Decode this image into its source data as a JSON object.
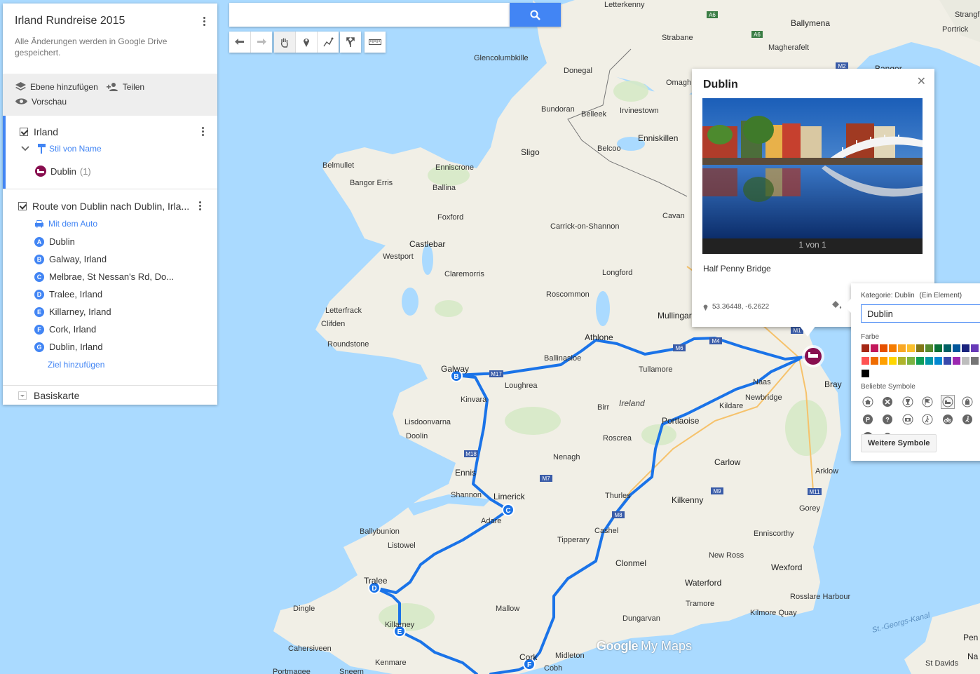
{
  "app": {
    "title": "Irland Rundreise 2015",
    "subtitle": "Alle Änderungen werden in Google Drive gespeichert.",
    "logo_text_1": "Google",
    "logo_text_2": "My Maps"
  },
  "toolbar": {
    "add_layer": "Ebene hinzufügen",
    "share": "Teilen",
    "preview": "Vorschau"
  },
  "search": {
    "value": "",
    "placeholder": ""
  },
  "layers": [
    {
      "name": "Irland",
      "style_label": "Stil von Name",
      "items": [
        {
          "label": "Dublin",
          "count": "(1)"
        }
      ]
    },
    {
      "name": "Route von Dublin nach Dublin, Irla...",
      "mode": "Mit dem Auto",
      "stops": [
        {
          "letter": "A",
          "label": "Dublin"
        },
        {
          "letter": "B",
          "label": "Galway, Irland"
        },
        {
          "letter": "C",
          "label": "Melbrae, St Nessan's Rd, Do..."
        },
        {
          "letter": "D",
          "label": "Tralee, Irland"
        },
        {
          "letter": "E",
          "label": "Killarney, Irland"
        },
        {
          "letter": "F",
          "label": "Cork, Irland"
        },
        {
          "letter": "G",
          "label": "Dublin, Irland"
        }
      ],
      "add_destination": "Ziel hinzufügen"
    }
  ],
  "basemap": {
    "label": "Basiskarte"
  },
  "info_window": {
    "title": "Dublin",
    "photo_counter": "1 von 1",
    "description": "Half Penny Bridge",
    "coordinates": "53.36448, -6.2622"
  },
  "style_popup": {
    "category": "Kategorie: Dublin",
    "count": "(Ein Element)",
    "name_value": "Dublin",
    "color_heading": "Farbe",
    "icons_heading": "Beliebte Symbole",
    "more_button": "Weitere Symbole",
    "colors": [
      "#a52714",
      "#c2185b",
      "#e65100",
      "#f57c00",
      "#f9a825",
      "#fbc02d",
      "#827717",
      "#558b2f",
      "#097138",
      "#006064",
      "#01579b",
      "#1a237e",
      "#673ab7",
      "#880e4f",
      "#ff5252",
      "#ef6c00",
      "#ffa000",
      "#ffd600",
      "#afb42b",
      "#7cb342",
      "#0f9d58",
      "#0097a7",
      "#0288d1",
      "#3949ab",
      "#9c27b0",
      "#bdbdbd",
      "#757575",
      "#424242",
      "#000000"
    ],
    "icons": [
      "home-icon",
      "close-icon",
      "trophy-icon",
      "flag-icon",
      "hotel-icon",
      "shopping-icon",
      "parking-icon",
      "help-icon",
      "camera-icon",
      "hiking-icon",
      "cycling-icon",
      "running-icon",
      "star-icon",
      "pin-icon"
    ]
  },
  "map": {
    "accent": "#4285f4",
    "route_color": "#1a73e8",
    "marker_color": "#880e4f",
    "labels": {
      "letterkenny": "Letterkenny",
      "ballymena": "Ballymena",
      "strabane": "Strabane",
      "magherafelt": "Magherafelt",
      "glencolumbkille": "Glencolumbkille",
      "donegal": "Donegal",
      "omagh": "Omagh",
      "bundoran": "Bundoran",
      "belleek": "Belleek",
      "irvinestown": "Irvinestown",
      "enniskillen": "Enniskillen",
      "belcoo": "Belcoo",
      "sligo": "Sligo",
      "belmullet": "Belmullet",
      "enniscrone": "Enniscrone",
      "bangorerris": "Bangor Erris",
      "ballina": "Ballina",
      "foxford": "Foxford",
      "cavan": "Cavan",
      "carrick": "Carrick-on-Shannon",
      "castlebar": "Castlebar",
      "westport": "Westport",
      "claremorris": "Claremorris",
      "longford": "Longford",
      "roscommon": "Roscommon",
      "mullingar": "Mullingar",
      "letterfrack": "Letterfrack",
      "clifden": "Clifden",
      "roundstone": "Roundstone",
      "athlone": "Athlone",
      "ballinasloe": "Ballinasloe",
      "tullamore": "Tullamore",
      "galway": "Galway",
      "loughrea": "Loughrea",
      "kinvara": "Kinvara",
      "lisdoonvarna": "Lisdoonvarna",
      "doolin": "Doolin",
      "ennis": "Ennis",
      "shannon": "Shannon",
      "limerick": "Limerick",
      "adare": "Adare",
      "ballybunion": "Ballybunion",
      "listowel": "Listowel",
      "tralee": "Tralee",
      "dingle": "Dingle",
      "killarney": "Killarney",
      "kenmare": "Kenmare",
      "cahersiveen": "Cahersiveen",
      "portmagee": "Portmagee",
      "sneem": "Sneem",
      "mallow": "Mallow",
      "cork": "Cork",
      "midleton": "Midleton",
      "cobh": "Cobh",
      "dungarvan": "Dungarvan",
      "tramore": "Tramore",
      "waterford": "Waterford",
      "clonmel": "Clonmel",
      "cashel": "Cashel",
      "tipperary": "Tipperary",
      "thurles": "Thurles",
      "nenagh": "Nenagh",
      "birr": "Birr",
      "roscrea": "Roscrea",
      "portlaoise": "Portlaoise",
      "kildare": "Kildare",
      "newbridge": "Newbridge",
      "naas": "Naas",
      "carlow": "Carlow",
      "kilkenny": "Kilkenny",
      "newross": "New Ross",
      "wexford": "Wexford",
      "rosslare": "Rosslare Harbour",
      "kilmorequay": "Kilmore Quay",
      "enniscorthy": "Enniscorthy",
      "gorey": "Gorey",
      "arklow": "Arklow",
      "bray": "Bray",
      "ireland": "Ireland",
      "stgeorges": "St.-Georgs-Kanal",
      "stdavids": "St Davids",
      "strangford": "Strangford",
      "portrick": "Portrick",
      "bangor": "Bangor",
      "pen": "Pen",
      "na": "Na"
    },
    "road_labels": [
      "A6",
      "A6",
      "M2",
      "M4",
      "M6",
      "M17",
      "M18",
      "M7",
      "M8",
      "M9",
      "M11",
      "M1"
    ]
  }
}
